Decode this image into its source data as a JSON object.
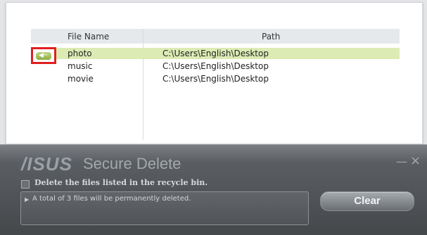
{
  "list": {
    "columns": {
      "file_name": "File Name",
      "path": "Path"
    },
    "rows": [
      {
        "name": "photo",
        "path": "C:\\Users\\English\\Desktop",
        "selected": true
      },
      {
        "name": "music",
        "path": "C:\\Users\\English\\Desktop",
        "selected": false
      },
      {
        "name": "movie",
        "path": "C:\\Users\\English\\Desktop",
        "selected": false
      }
    ],
    "restore_icon": "left-arrow-icon"
  },
  "window": {
    "brand": "/ISUS",
    "title": "Secure Delete",
    "minimize_icon": "minimize-icon",
    "close_icon": "close-icon"
  },
  "options": {
    "delete_recycle_label": "Delete the files listed in the recycle bin.",
    "delete_recycle_checked": false
  },
  "message": {
    "text": "A total of 3 files will be permanently deleted."
  },
  "actions": {
    "clear_label": "Clear"
  },
  "colors": {
    "selected_row": "#dcebb4",
    "highlight_border": "#e02020",
    "panel_dark": "#45484b"
  }
}
